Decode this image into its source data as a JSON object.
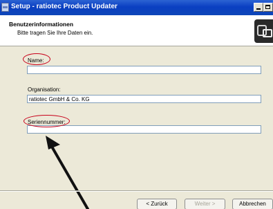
{
  "window": {
    "title": "Setup - ratiotec Product Updater"
  },
  "header": {
    "title": "Benutzerinformationen",
    "subtitle": "Bitte tragen Sie Ihre Daten ein."
  },
  "form": {
    "name": {
      "label": "Name:",
      "value": ""
    },
    "organisation": {
      "label": "Organisation:",
      "value": "ratiotec GmbH & Co. KG"
    },
    "serial": {
      "label": "Seriennummer:",
      "value": ""
    }
  },
  "buttons": {
    "back": "< Zurück",
    "next": "Weiter >",
    "cancel": "Abbrechen"
  },
  "colors": {
    "annotation": "#C8001A",
    "titlebar": "#0A3FC2",
    "dialog_bg": "#ECE9D8"
  }
}
